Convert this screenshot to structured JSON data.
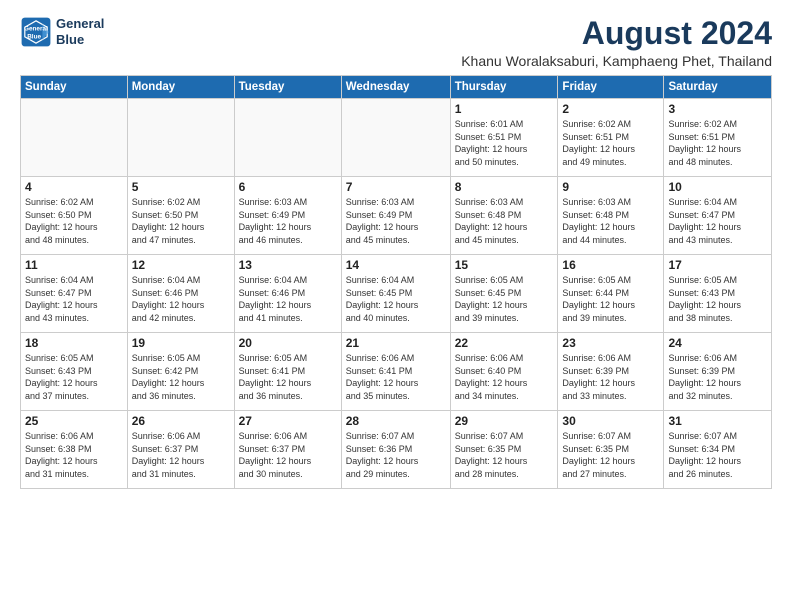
{
  "logo": {
    "line1": "General",
    "line2": "Blue"
  },
  "title": "August 2024",
  "subtitle": "Khanu Woralaksaburi, Kamphaeng Phet, Thailand",
  "headers": [
    "Sunday",
    "Monday",
    "Tuesday",
    "Wednesday",
    "Thursday",
    "Friday",
    "Saturday"
  ],
  "weeks": [
    [
      {
        "day": "",
        "info": ""
      },
      {
        "day": "",
        "info": ""
      },
      {
        "day": "",
        "info": ""
      },
      {
        "day": "",
        "info": ""
      },
      {
        "day": "1",
        "info": "Sunrise: 6:01 AM\nSunset: 6:51 PM\nDaylight: 12 hours\nand 50 minutes."
      },
      {
        "day": "2",
        "info": "Sunrise: 6:02 AM\nSunset: 6:51 PM\nDaylight: 12 hours\nand 49 minutes."
      },
      {
        "day": "3",
        "info": "Sunrise: 6:02 AM\nSunset: 6:51 PM\nDaylight: 12 hours\nand 48 minutes."
      }
    ],
    [
      {
        "day": "4",
        "info": "Sunrise: 6:02 AM\nSunset: 6:50 PM\nDaylight: 12 hours\nand 48 minutes."
      },
      {
        "day": "5",
        "info": "Sunrise: 6:02 AM\nSunset: 6:50 PM\nDaylight: 12 hours\nand 47 minutes."
      },
      {
        "day": "6",
        "info": "Sunrise: 6:03 AM\nSunset: 6:49 PM\nDaylight: 12 hours\nand 46 minutes."
      },
      {
        "day": "7",
        "info": "Sunrise: 6:03 AM\nSunset: 6:49 PM\nDaylight: 12 hours\nand 45 minutes."
      },
      {
        "day": "8",
        "info": "Sunrise: 6:03 AM\nSunset: 6:48 PM\nDaylight: 12 hours\nand 45 minutes."
      },
      {
        "day": "9",
        "info": "Sunrise: 6:03 AM\nSunset: 6:48 PM\nDaylight: 12 hours\nand 44 minutes."
      },
      {
        "day": "10",
        "info": "Sunrise: 6:04 AM\nSunset: 6:47 PM\nDaylight: 12 hours\nand 43 minutes."
      }
    ],
    [
      {
        "day": "11",
        "info": "Sunrise: 6:04 AM\nSunset: 6:47 PM\nDaylight: 12 hours\nand 43 minutes."
      },
      {
        "day": "12",
        "info": "Sunrise: 6:04 AM\nSunset: 6:46 PM\nDaylight: 12 hours\nand 42 minutes."
      },
      {
        "day": "13",
        "info": "Sunrise: 6:04 AM\nSunset: 6:46 PM\nDaylight: 12 hours\nand 41 minutes."
      },
      {
        "day": "14",
        "info": "Sunrise: 6:04 AM\nSunset: 6:45 PM\nDaylight: 12 hours\nand 40 minutes."
      },
      {
        "day": "15",
        "info": "Sunrise: 6:05 AM\nSunset: 6:45 PM\nDaylight: 12 hours\nand 39 minutes."
      },
      {
        "day": "16",
        "info": "Sunrise: 6:05 AM\nSunset: 6:44 PM\nDaylight: 12 hours\nand 39 minutes."
      },
      {
        "day": "17",
        "info": "Sunrise: 6:05 AM\nSunset: 6:43 PM\nDaylight: 12 hours\nand 38 minutes."
      }
    ],
    [
      {
        "day": "18",
        "info": "Sunrise: 6:05 AM\nSunset: 6:43 PM\nDaylight: 12 hours\nand 37 minutes."
      },
      {
        "day": "19",
        "info": "Sunrise: 6:05 AM\nSunset: 6:42 PM\nDaylight: 12 hours\nand 36 minutes."
      },
      {
        "day": "20",
        "info": "Sunrise: 6:05 AM\nSunset: 6:41 PM\nDaylight: 12 hours\nand 36 minutes."
      },
      {
        "day": "21",
        "info": "Sunrise: 6:06 AM\nSunset: 6:41 PM\nDaylight: 12 hours\nand 35 minutes."
      },
      {
        "day": "22",
        "info": "Sunrise: 6:06 AM\nSunset: 6:40 PM\nDaylight: 12 hours\nand 34 minutes."
      },
      {
        "day": "23",
        "info": "Sunrise: 6:06 AM\nSunset: 6:39 PM\nDaylight: 12 hours\nand 33 minutes."
      },
      {
        "day": "24",
        "info": "Sunrise: 6:06 AM\nSunset: 6:39 PM\nDaylight: 12 hours\nand 32 minutes."
      }
    ],
    [
      {
        "day": "25",
        "info": "Sunrise: 6:06 AM\nSunset: 6:38 PM\nDaylight: 12 hours\nand 31 minutes."
      },
      {
        "day": "26",
        "info": "Sunrise: 6:06 AM\nSunset: 6:37 PM\nDaylight: 12 hours\nand 31 minutes."
      },
      {
        "day": "27",
        "info": "Sunrise: 6:06 AM\nSunset: 6:37 PM\nDaylight: 12 hours\nand 30 minutes."
      },
      {
        "day": "28",
        "info": "Sunrise: 6:07 AM\nSunset: 6:36 PM\nDaylight: 12 hours\nand 29 minutes."
      },
      {
        "day": "29",
        "info": "Sunrise: 6:07 AM\nSunset: 6:35 PM\nDaylight: 12 hours\nand 28 minutes."
      },
      {
        "day": "30",
        "info": "Sunrise: 6:07 AM\nSunset: 6:35 PM\nDaylight: 12 hours\nand 27 minutes."
      },
      {
        "day": "31",
        "info": "Sunrise: 6:07 AM\nSunset: 6:34 PM\nDaylight: 12 hours\nand 26 minutes."
      }
    ]
  ]
}
